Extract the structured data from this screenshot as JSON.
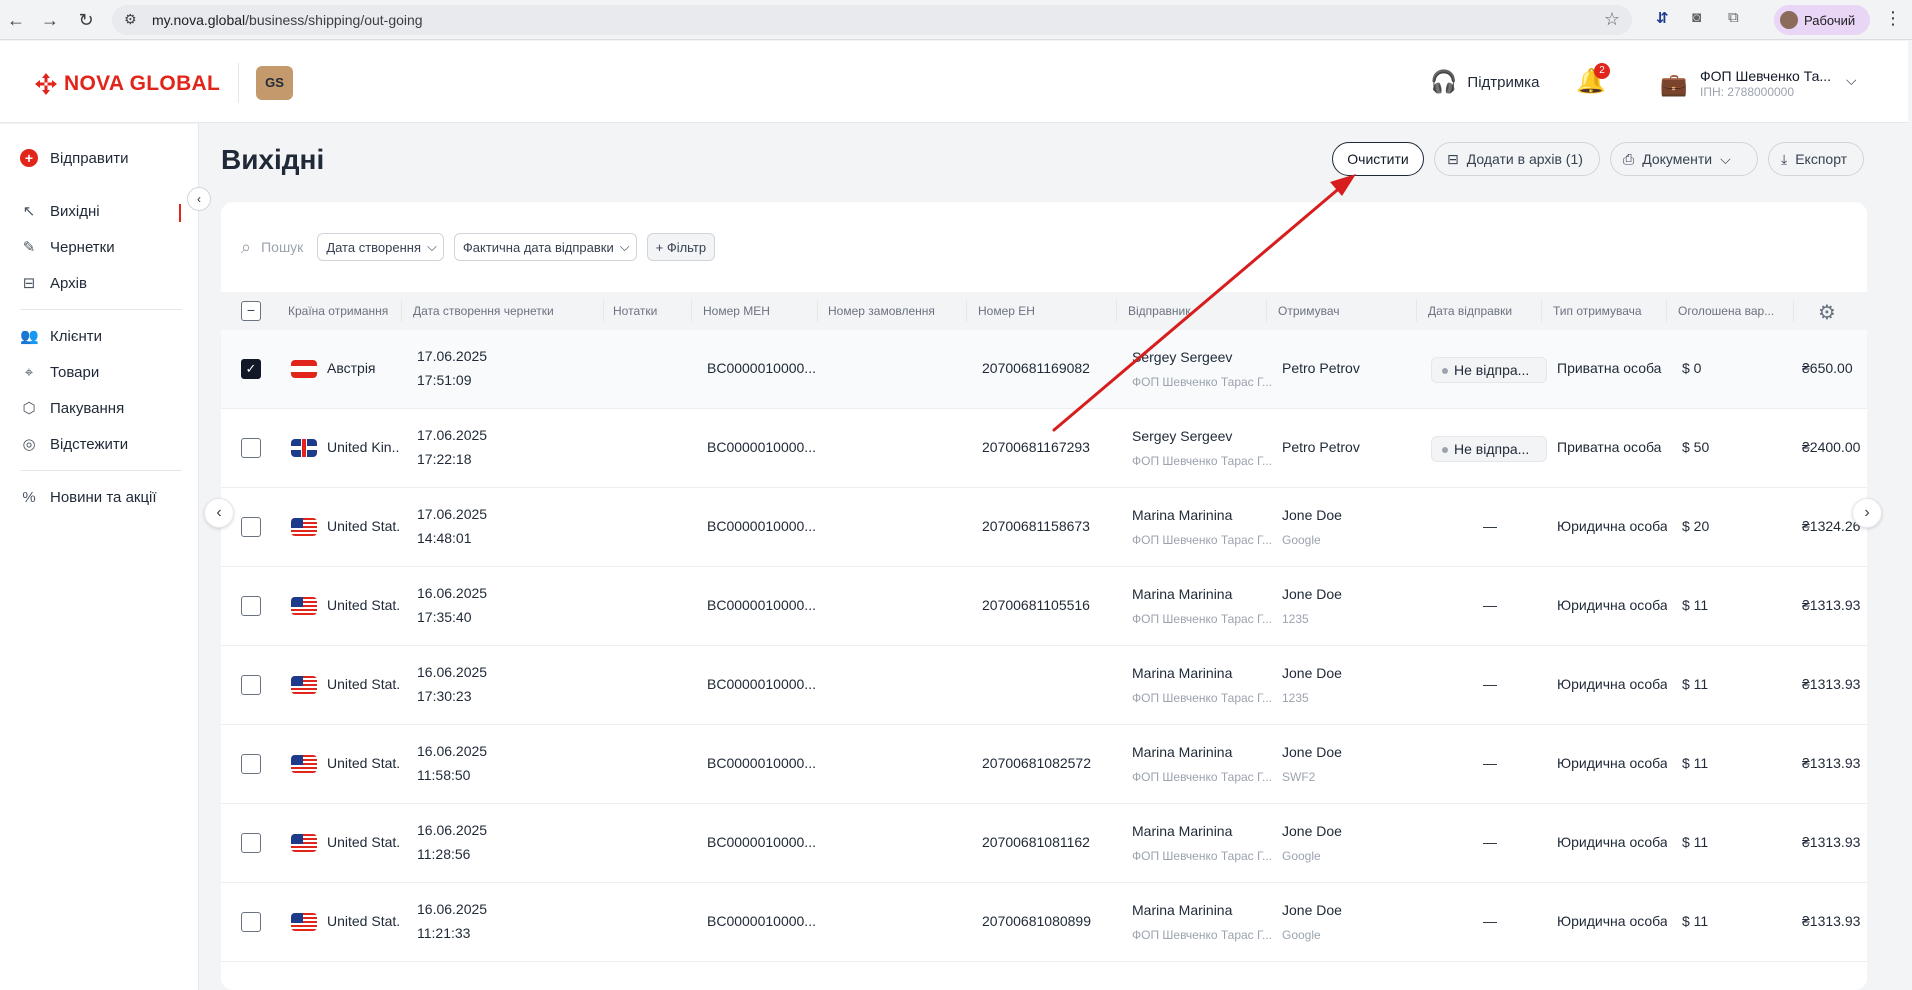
{
  "browser": {
    "url_host": "my.nova.global",
    "url_path": "/business/shipping/out-going",
    "profile_name": "Рабочий"
  },
  "header": {
    "logo_text": "NOVA GLOBAL",
    "gs_badge": "GS",
    "support_label": "Підтримка",
    "notification_count": "2",
    "company_name": "ФОП Шевченко Та...",
    "company_inn": "ІПН: 2788000000"
  },
  "sidebar": {
    "items": [
      {
        "label": "Відправити",
        "icon": "plus-circle-icon"
      },
      {
        "label": "Вихідні",
        "icon": "arrow-up-left-icon",
        "active": true
      },
      {
        "label": "Чернетки",
        "icon": "edit-icon"
      },
      {
        "label": "Архів",
        "icon": "archive-icon"
      },
      {
        "label": "Клієнти",
        "icon": "users-icon"
      },
      {
        "label": "Товари",
        "icon": "tag-icon"
      },
      {
        "label": "Пакування",
        "icon": "package-icon"
      },
      {
        "label": "Відстежити",
        "icon": "target-icon"
      },
      {
        "label": "Новини та акції",
        "icon": "percent-icon"
      }
    ]
  },
  "page": {
    "title": "Вихідні",
    "actions": {
      "clear": "Очистити",
      "archive": "Додати в архів (1)",
      "documents": "Документи",
      "export": "Експорт"
    }
  },
  "filters": {
    "search_label": "Пошук",
    "created_date": "Дата створення",
    "actual_send_date": "Фактична дата відправки",
    "add_filter": "+ Фільтр"
  },
  "table": {
    "columns": [
      "Країна отримання",
      "Дата створення чернетки",
      "Нотатки",
      "Номер МЕН",
      "Номер замовлення",
      "Номер ЕН",
      "Відправник",
      "Отримувач",
      "Дата відправки",
      "Тип отримувача",
      "Оголошена вар..."
    ],
    "rows": [
      {
        "checked": true,
        "flag": "at",
        "country": "Австрія",
        "date": "17.06.2025",
        "time": "17:51:09",
        "men": "BC0000010000...",
        "en": "20700681169082",
        "sender": "Sergey Sergeev",
        "sender_company": "ФОП Шевченко Тарас Г...",
        "recipient": "Petro Petrov",
        "recipient_sub": "",
        "send_date": "Не відпра...",
        "recipient_type": "Приватна особа",
        "declared": "$ 0",
        "cost": "₴650.00"
      },
      {
        "checked": false,
        "flag": "gb",
        "country": "United Kin...",
        "date": "17.06.2025",
        "time": "17:22:18",
        "men": "BC0000010000...",
        "en": "20700681167293",
        "sender": "Sergey Sergeev",
        "sender_company": "ФОП Шевченко Тарас Г...",
        "recipient": "Petro Petrov",
        "recipient_sub": "",
        "send_date": "Не відпра...",
        "recipient_type": "Приватна особа",
        "declared": "$ 50",
        "cost": "₴2400.00"
      },
      {
        "checked": false,
        "flag": "us",
        "country": "United Stat...",
        "date": "17.06.2025",
        "time": "14:48:01",
        "men": "BC0000010000...",
        "en": "20700681158673",
        "sender": "Marina Marinina",
        "sender_company": "ФОП Шевченко Тарас Г...",
        "recipient": "Jone Doe",
        "recipient_sub": "Google",
        "send_date": "—",
        "recipient_type": "Юридична особа",
        "declared": "$ 20",
        "cost": "₴1324.26"
      },
      {
        "checked": false,
        "flag": "us",
        "country": "United Stat...",
        "date": "16.06.2025",
        "time": "17:35:40",
        "men": "BC0000010000...",
        "en": "20700681105516",
        "sender": "Marina Marinina",
        "sender_company": "ФОП Шевченко Тарас Г...",
        "recipient": "Jone Doe",
        "recipient_sub": "1235",
        "send_date": "—",
        "recipient_type": "Юридична особа",
        "declared": "$ 11",
        "cost": "₴1313.93"
      },
      {
        "checked": false,
        "flag": "us",
        "country": "United Stat...",
        "date": "16.06.2025",
        "time": "17:30:23",
        "men": "BC0000010000...",
        "en": "",
        "sender": "Marina Marinina",
        "sender_company": "ФОП Шевченко Тарас Г...",
        "recipient": "Jone Doe",
        "recipient_sub": "1235",
        "send_date": "—",
        "recipient_type": "Юридична особа",
        "declared": "$ 11",
        "cost": "₴1313.93"
      },
      {
        "checked": false,
        "flag": "us",
        "country": "United Stat...",
        "date": "16.06.2025",
        "time": "11:58:50",
        "men": "BC0000010000...",
        "en": "20700681082572",
        "sender": "Marina Marinina",
        "sender_company": "ФОП Шевченко Тарас Г...",
        "recipient": "Jone Doe",
        "recipient_sub": "SWF2",
        "send_date": "—",
        "recipient_type": "Юридична особа",
        "declared": "$ 11",
        "cost": "₴1313.93"
      },
      {
        "checked": false,
        "flag": "us",
        "country": "United Stat...",
        "date": "16.06.2025",
        "time": "11:28:56",
        "men": "BC0000010000...",
        "en": "20700681081162",
        "sender": "Marina Marinina",
        "sender_company": "ФОП Шевченко Тарас Г...",
        "recipient": "Jone Doe",
        "recipient_sub": "Google",
        "send_date": "—",
        "recipient_type": "Юридична особа",
        "declared": "$ 11",
        "cost": "₴1313.93"
      },
      {
        "checked": false,
        "flag": "us",
        "country": "United Stat...",
        "date": "16.06.2025",
        "time": "11:21:33",
        "men": "BC0000010000...",
        "en": "20700681080899",
        "sender": "Marina Marinina",
        "sender_company": "ФОП Шевченко Тарас Г...",
        "recipient": "Jone Doe",
        "recipient_sub": "Google",
        "send_date": "—",
        "recipient_type": "Юридична особа",
        "declared": "$ 11",
        "cost": "₴1313.93"
      }
    ]
  },
  "colors": {
    "brand_red": "#e1251b",
    "annotation_arrow": "#d71d1d"
  }
}
